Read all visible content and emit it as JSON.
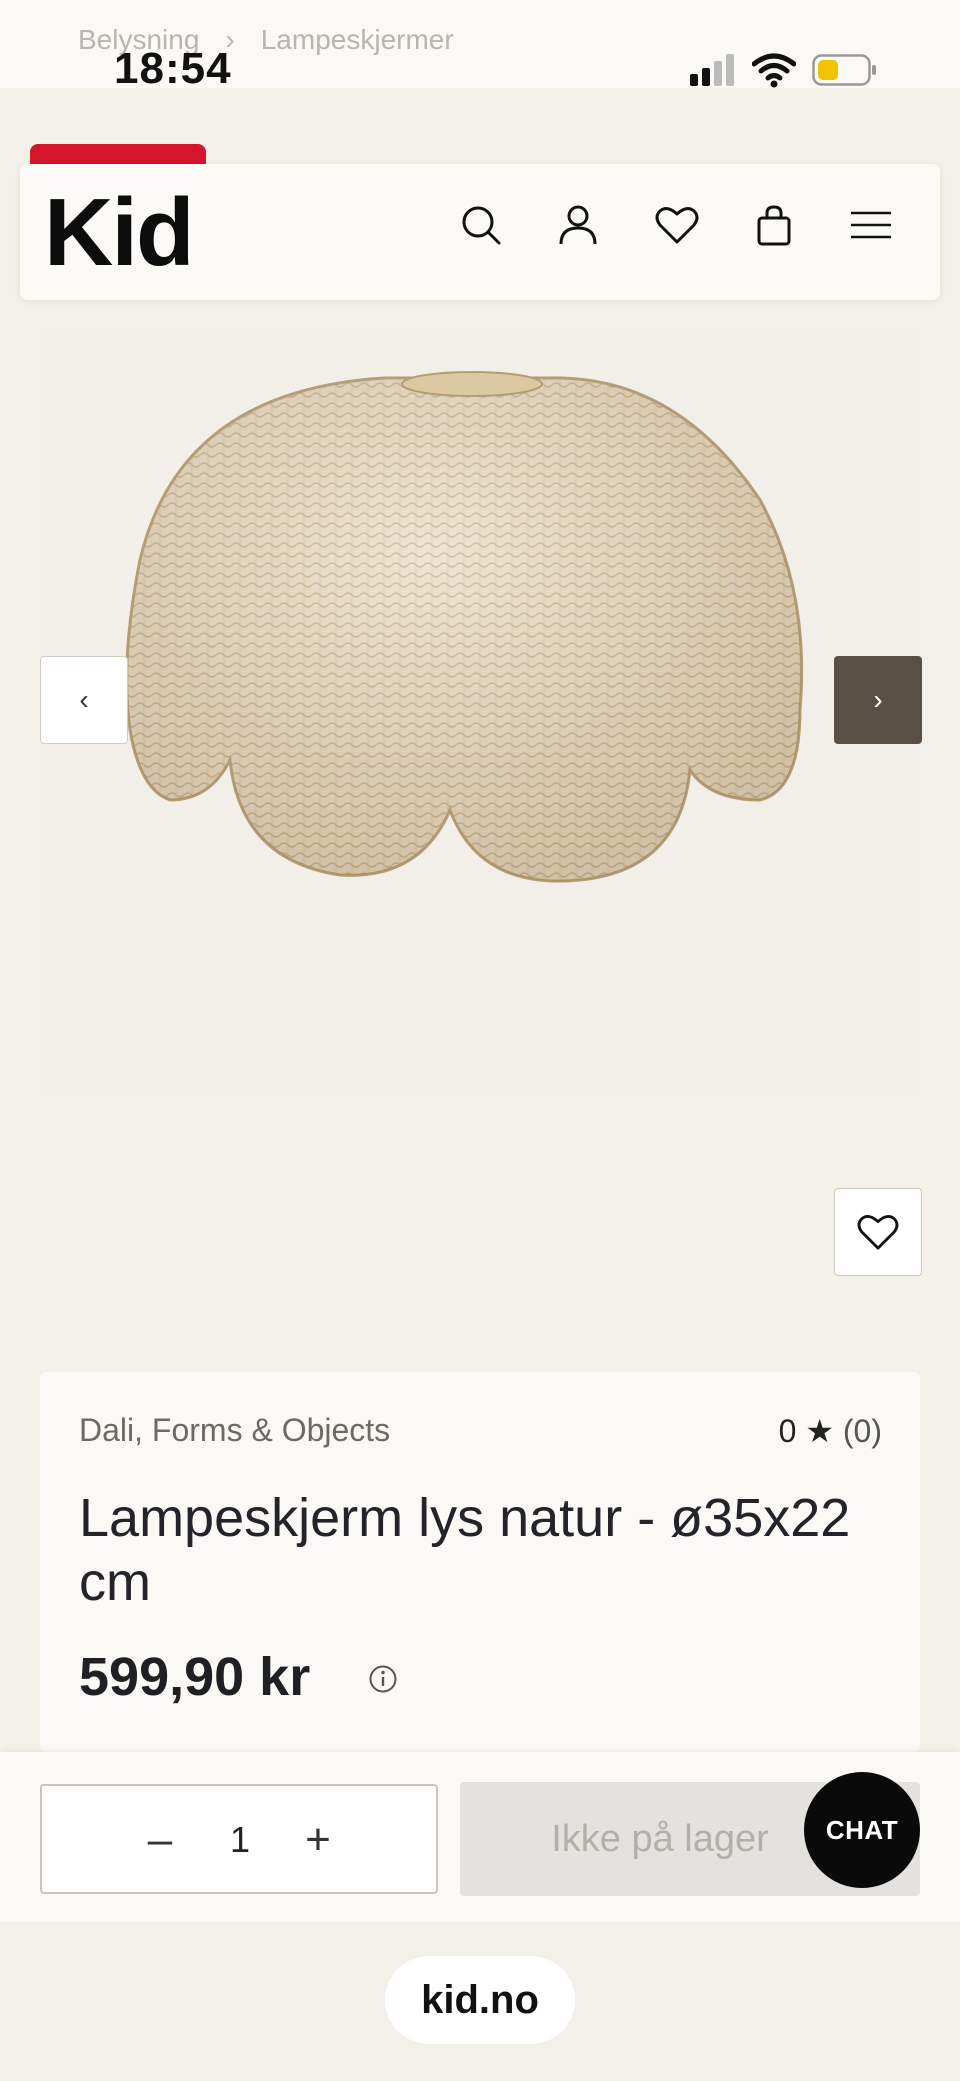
{
  "status_bar": {
    "time": "18:54"
  },
  "breadcrumb": {
    "items": [
      "Belysning",
      "Lampeskjermer"
    ],
    "separator": "›"
  },
  "header": {
    "logo": "Kid",
    "icons": [
      "search-icon",
      "account-icon",
      "wishlist-icon",
      "cart-icon",
      "menu-icon"
    ]
  },
  "gallery": {
    "prev_label": "‹",
    "next_label": "›"
  },
  "product": {
    "brand": "Dali, Forms & Objects",
    "rating_value": "0",
    "rating_star": "★",
    "rating_count": "(0)",
    "title": "Lampeskjerm lys natur - ø35x22 cm",
    "price": "599,90 kr"
  },
  "purchase": {
    "minus_label": "–",
    "quantity": "1",
    "plus_label": "+",
    "cart_button_label": "Ikke på lager",
    "chat_label": "CHAT"
  },
  "browser": {
    "url": "kid.no"
  },
  "colors": {
    "page_bg": "#f3efe9",
    "sale_tab": "#d4152c",
    "next_button": "#5a4f44",
    "chat_button": "#0a0a0a"
  }
}
